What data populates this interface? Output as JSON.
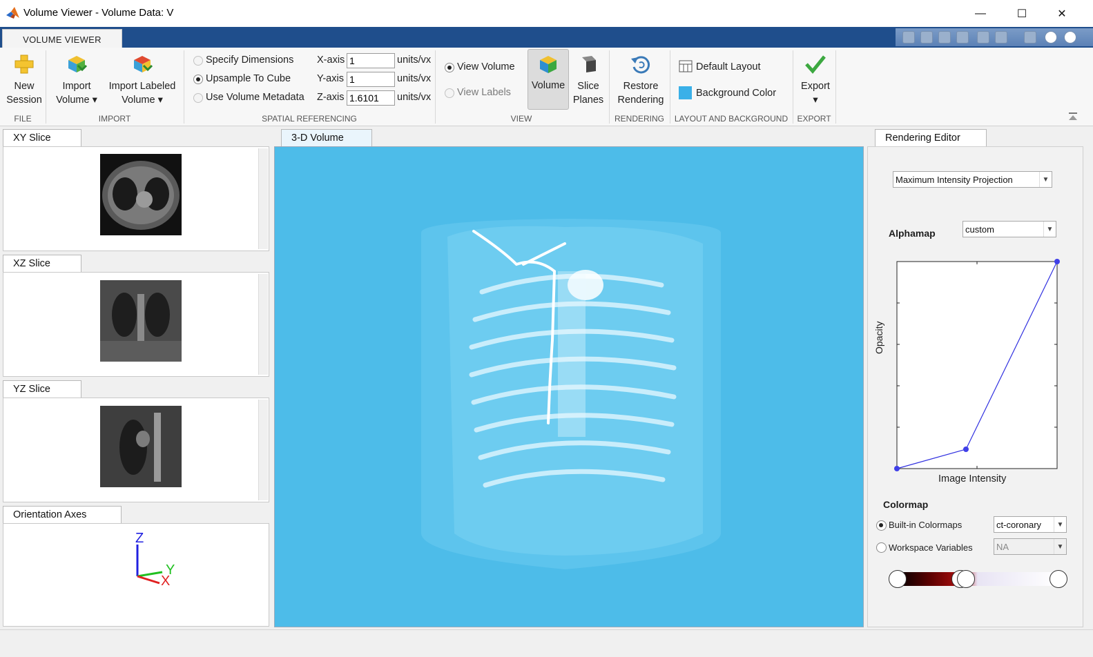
{
  "window": {
    "title": "Volume Viewer - Volume Data: V",
    "controls": {
      "minimize": "—",
      "maximize": "☐",
      "close": "✕"
    }
  },
  "ribbon": {
    "tab": "VOLUME VIEWER",
    "groups": {
      "file": "FILE",
      "import": "IMPORT",
      "spatial": "SPATIAL REFERENCING",
      "view": "VIEW",
      "rendering": "RENDERING",
      "layout": "LAYOUT AND BACKGROUND",
      "export": "EXPORT"
    },
    "buttons": {
      "new_session_1": "New",
      "new_session_2": "Session",
      "import_volume_1": "Import",
      "import_volume_2": "Volume",
      "import_labeled_1": "Import Labeled",
      "import_labeled_2": "Volume",
      "volume": "Volume",
      "slice_planes_1": "Slice",
      "slice_planes_2": "Planes",
      "restore_1": "Restore",
      "restore_2": "Rendering",
      "default_layout": "Default Layout",
      "background_color": "Background Color",
      "export": "Export"
    },
    "spatial": {
      "specify_dimensions": "Specify Dimensions",
      "upsample_to_cube": "Upsample To Cube",
      "use_volume_metadata": "Use Volume Metadata",
      "x_label": "X-axis",
      "y_label": "Y-axis",
      "z_label": "Z-axis",
      "x_value": "1",
      "y_value": "1",
      "z_value": "1.6101",
      "unit": "units/vx"
    },
    "view": {
      "view_volume": "View Volume",
      "view_labels": "View Labels"
    },
    "colors": {
      "background_swatch": "#3ab0e8",
      "tabstrip": "#1f4e8c"
    }
  },
  "left_panels": {
    "xy": "XY Slice",
    "xz": "XZ Slice",
    "yz": "YZ Slice",
    "orientation": "Orientation Axes",
    "axes": {
      "z": "Z",
      "y": "Y",
      "x": "X"
    }
  },
  "center": {
    "tab": "3-D Volume",
    "background": "#4dbce9"
  },
  "right_panel": {
    "tab": "Rendering Editor",
    "render_mode": "Maximum Intensity Projection",
    "alphamap_label": "Alphamap",
    "alphamap_value": "custom",
    "ylabel": "Opacity",
    "xlabel": "Image Intensity",
    "colormap_label": "Colormap",
    "builtin_label": "Built-in Colormaps",
    "builtin_value": "ct-coronary",
    "workspace_label": "Workspace Variables",
    "workspace_value": "NA"
  }
}
